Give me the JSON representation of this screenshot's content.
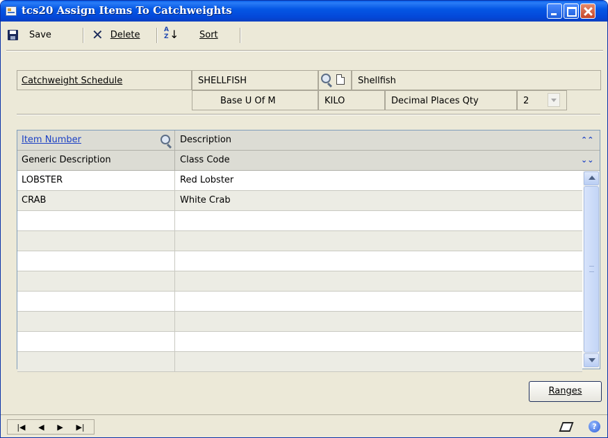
{
  "window": {
    "title": "tcs20 Assign Items To Catchweights"
  },
  "toolbar": {
    "save_label": "Save",
    "delete_label": "Delete",
    "sort_label": "Sort"
  },
  "form": {
    "schedule_label": "Catchweight Schedule",
    "schedule_value": "SHELLFISH",
    "schedule_desc": "Shellfish",
    "base_uom_label": "Base U Of M",
    "base_uom_value": "KILO",
    "decimal_label": "Decimal Places Qty",
    "decimal_value": "2"
  },
  "grid": {
    "header1": {
      "col1": "Item Number",
      "col2": "Description"
    },
    "header2": {
      "col1": "Generic Description",
      "col2": "Class Code"
    },
    "rows": [
      {
        "col1": "LOBSTER",
        "col2": "Red Lobster"
      },
      {
        "col1": "CRAB",
        "col2": "White Crab"
      },
      {
        "col1": "",
        "col2": ""
      },
      {
        "col1": "",
        "col2": ""
      },
      {
        "col1": "",
        "col2": ""
      },
      {
        "col1": "",
        "col2": ""
      },
      {
        "col1": "",
        "col2": ""
      },
      {
        "col1": "",
        "col2": ""
      },
      {
        "col1": "",
        "col2": ""
      },
      {
        "col1": "",
        "col2": ""
      }
    ]
  },
  "buttons": {
    "ranges_label": "Ranges"
  },
  "icons": {
    "save": "save-icon",
    "delete": "delete-icon",
    "sort": "sort-icon",
    "lookup": "lookup-icon",
    "note": "note-icon",
    "help": "help-icon"
  },
  "colors": {
    "titlebar": "#0557e5",
    "window_bg": "#ece9d8",
    "link": "#1a3fc4",
    "row_alt": "#ecece4"
  }
}
